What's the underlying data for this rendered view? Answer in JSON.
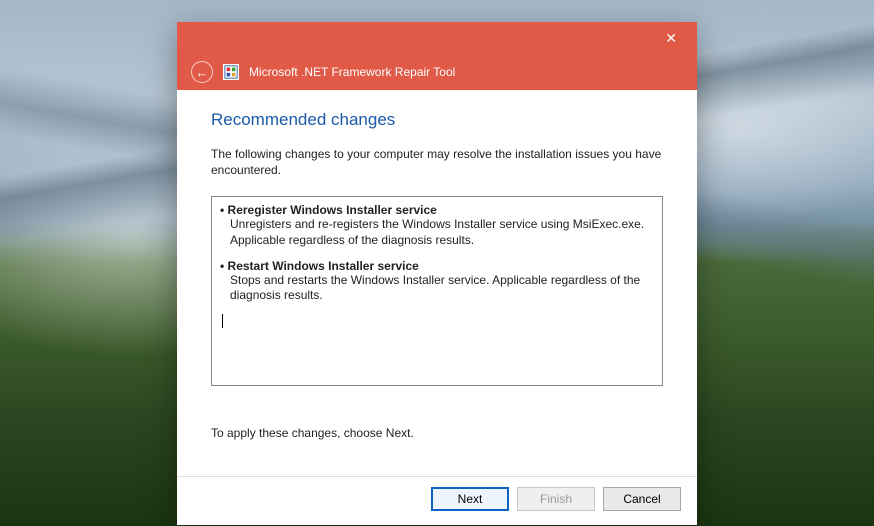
{
  "window": {
    "title": "Microsoft .NET Framework Repair Tool"
  },
  "page": {
    "heading": "Recommended changes",
    "intro": "The following changes to your computer may resolve the installation issues you have encountered.",
    "hint": "To apply these changes, choose Next."
  },
  "changes": [
    {
      "title": "Reregister Windows Installer service",
      "desc": "Unregisters and re-registers the Windows Installer service using MsiExec.exe. Applicable regardless of the diagnosis results."
    },
    {
      "title": "Restart Windows Installer service",
      "desc": "Stops and restarts the Windows Installer service. Applicable regardless of the diagnosis results."
    }
  ],
  "buttons": {
    "next": "Next",
    "finish": "Finish",
    "cancel": "Cancel"
  }
}
